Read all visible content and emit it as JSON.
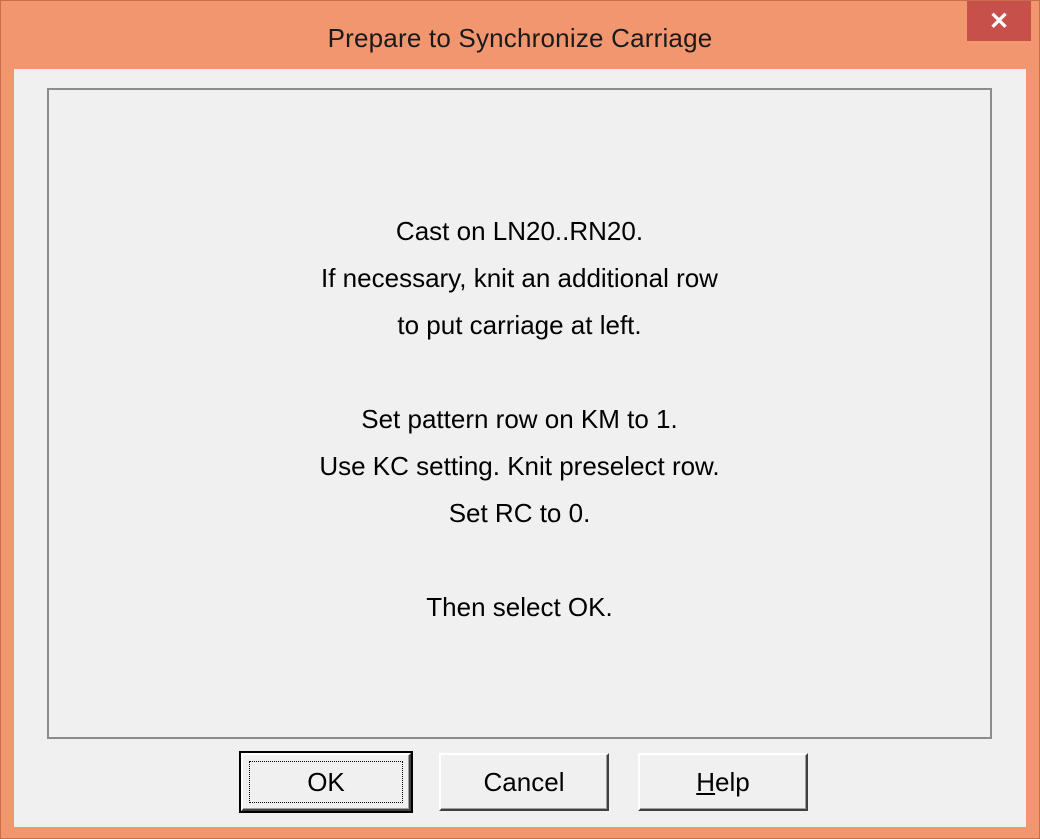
{
  "window": {
    "title": "Prepare to Synchronize Carriage",
    "close_glyph": "✕"
  },
  "message": {
    "lines": [
      "Cast on LN20..RN20.",
      "If necessary, knit an additional row",
      "to put carriage at left.",
      "",
      "Set pattern row on KM to 1.",
      "Use KC setting. Knit preselect row.",
      "Set RC to 0.",
      "",
      "Then select OK."
    ]
  },
  "buttons": {
    "ok_label": "OK",
    "cancel_label": "Cancel",
    "help_accel": "H",
    "help_rest": "elp"
  },
  "colors": {
    "title_bar": "#f29670",
    "close_button": "#c7504a",
    "client_background": "#f0f0f0"
  }
}
